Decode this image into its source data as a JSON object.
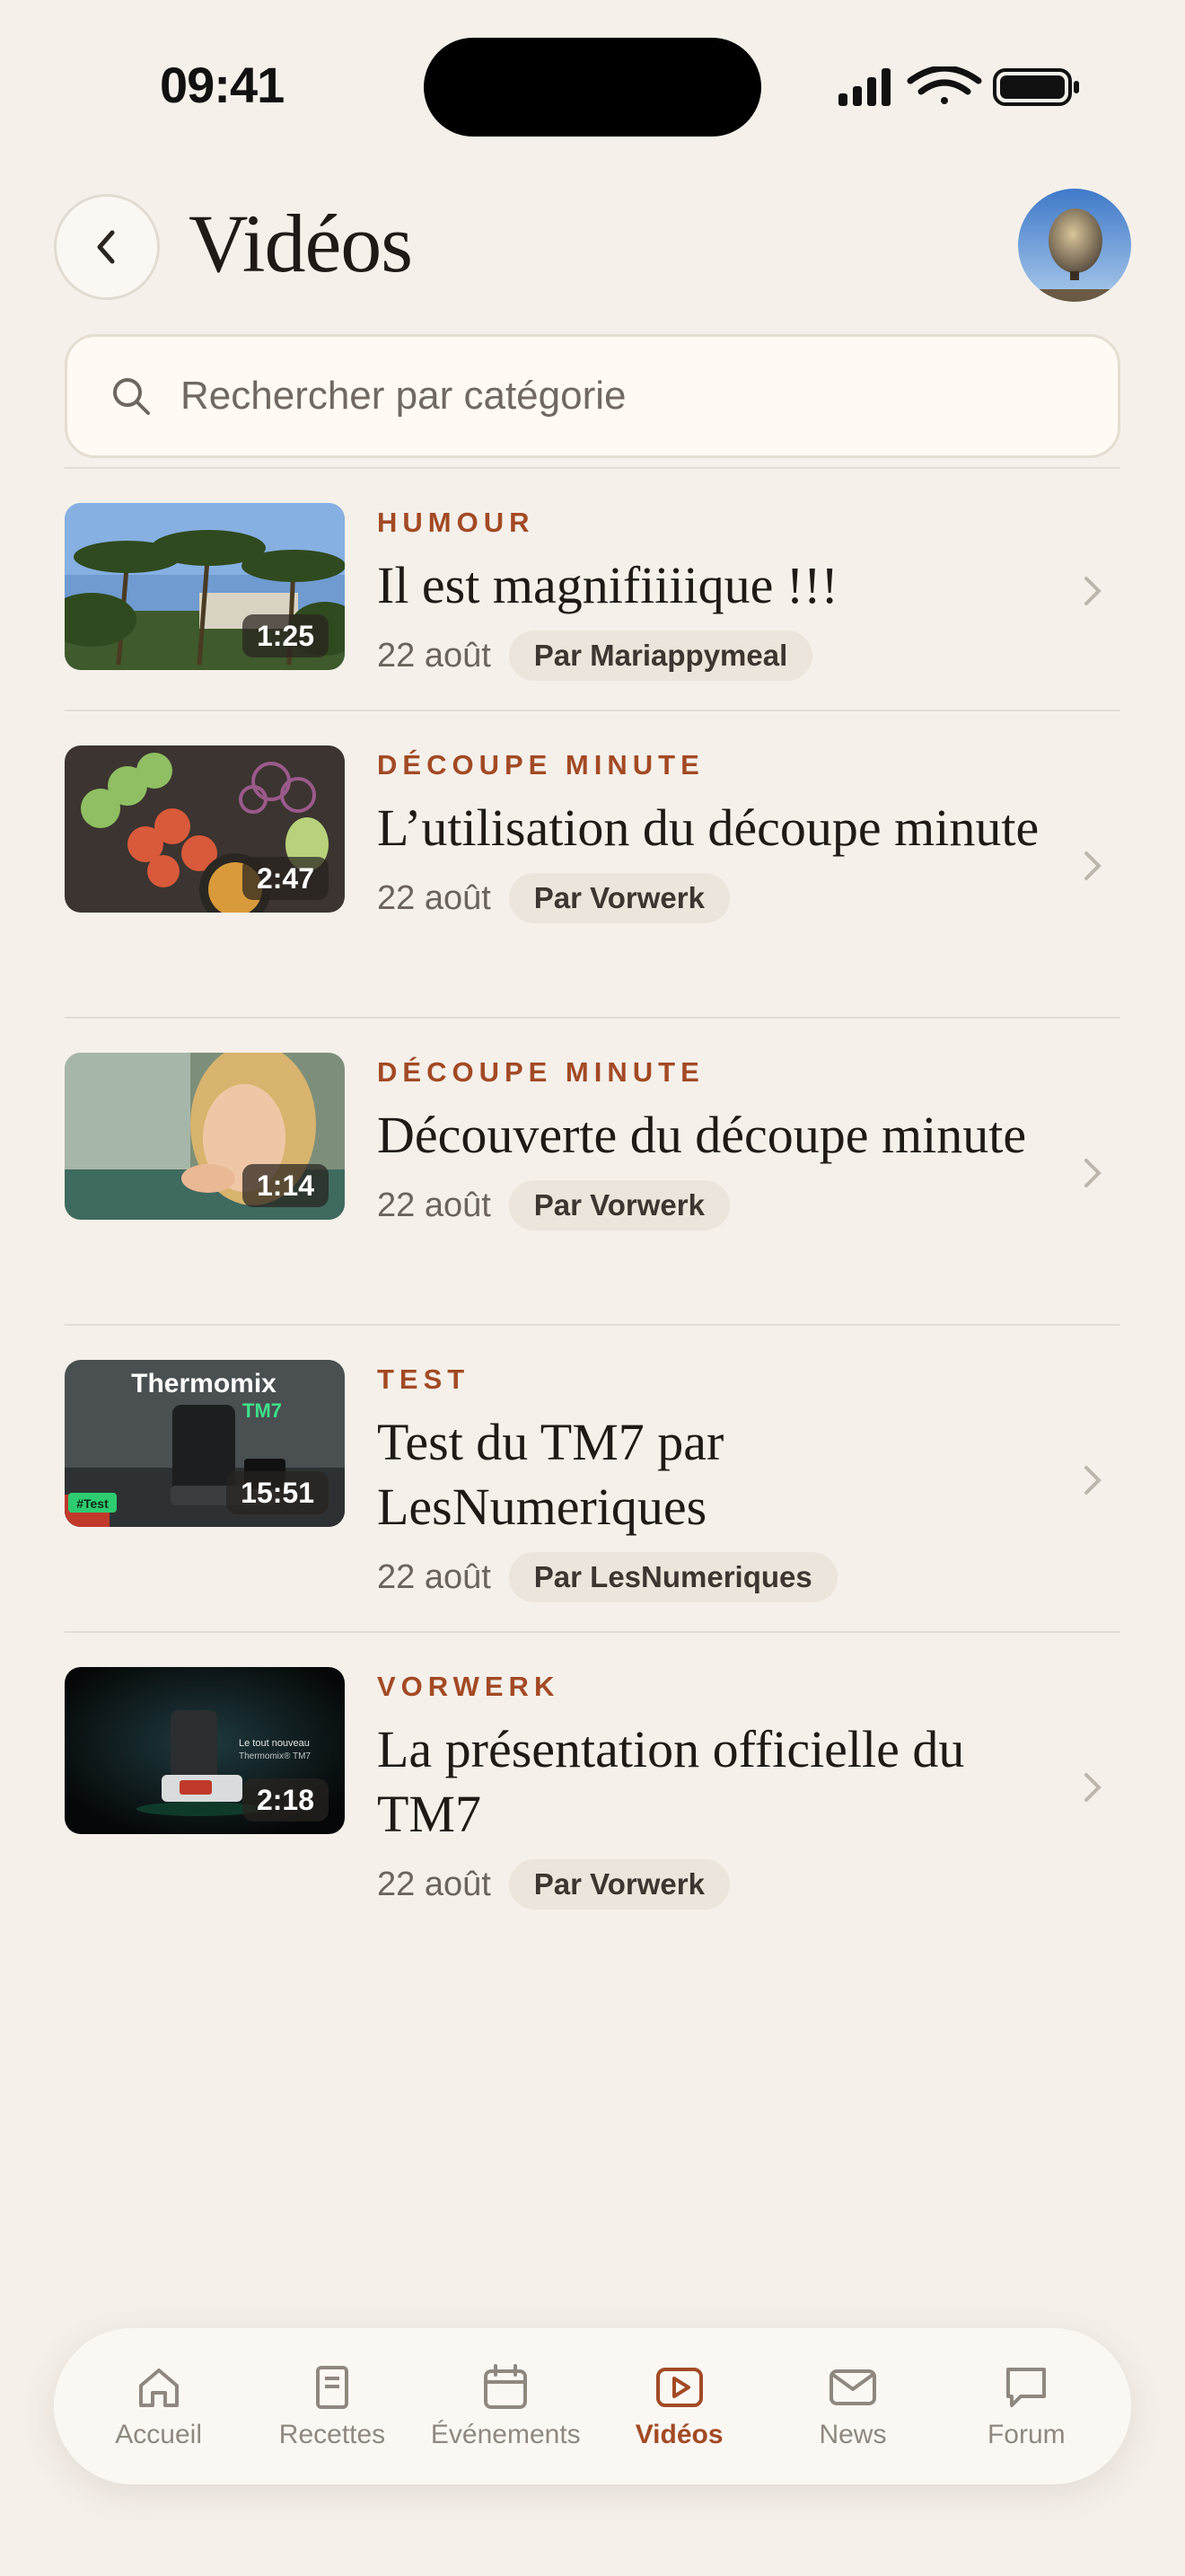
{
  "status_bar": {
    "time": "09:41"
  },
  "header": {
    "title": "Vidéos"
  },
  "search": {
    "placeholder": "Rechercher par catégorie"
  },
  "videos": [
    {
      "category": "HUMOUR",
      "title": "Il est magnifiiiique !!!",
      "date": "22 août",
      "author": "Par Mariappymeal",
      "duration": "1:25"
    },
    {
      "category": "DÉCOUPE MINUTE",
      "title": "L’utilisation du découpe minute",
      "date": "22 août",
      "author": "Par Vorwerk",
      "duration": "2:47"
    },
    {
      "category": "DÉCOUPE MINUTE",
      "title": "Découverte du découpe minute",
      "date": "22 août",
      "author": "Par Vorwerk",
      "duration": "1:14"
    },
    {
      "category": "TEST",
      "title": "Test du TM7 par LesNumeriques",
      "date": "22 août",
      "author": "Par LesNumeriques",
      "duration": "15:51",
      "thumb_text": "Thermomix",
      "thumb_badge": "TM7",
      "thumb_tag": "#Test"
    },
    {
      "category": "VORWERK",
      "title": "La présentation officielle du TM7",
      "date": "22 août",
      "author": "Par Vorwerk",
      "duration": "2:18",
      "thumb_text": "Le tout nouveau",
      "thumb_badge": "Thermomix® TM7"
    }
  ],
  "tabs": [
    {
      "label": "Accueil",
      "icon": "home-icon"
    },
    {
      "label": "Recettes",
      "icon": "recipe-icon"
    },
    {
      "label": "Événements",
      "icon": "calendar-icon"
    },
    {
      "label": "Vidéos",
      "icon": "play-icon",
      "active": true
    },
    {
      "label": "News",
      "icon": "mail-icon"
    },
    {
      "label": "Forum",
      "icon": "chat-icon"
    }
  ],
  "colors": {
    "accent": "#a24a25",
    "background": "#f5f0ea"
  }
}
